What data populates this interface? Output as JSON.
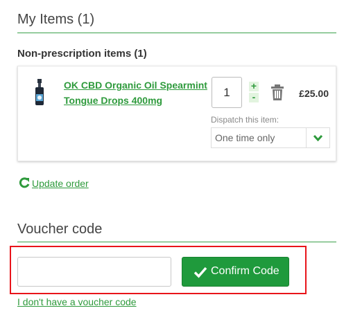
{
  "my_items": {
    "title": "My Items (1)"
  },
  "non_prescription": {
    "title": "Non-prescription items (1)"
  },
  "item": {
    "name": "OK CBD Organic Oil Spearmint Tongue Drops 400mg",
    "quantity": "1",
    "plus": "+",
    "minus": "-",
    "price": "£25.00",
    "dispatch_label": "Dispatch this item:",
    "dispatch_value": "One time only"
  },
  "update_order": {
    "label": "Update order"
  },
  "voucher": {
    "title": "Voucher code",
    "input_value": "",
    "confirm_label": "Confirm Code",
    "no_voucher_label": "I don't have a voucher code"
  },
  "colors": {
    "accent": "#2e9a3c",
    "button": "#1f9a3c",
    "highlight": "#e8141a"
  }
}
